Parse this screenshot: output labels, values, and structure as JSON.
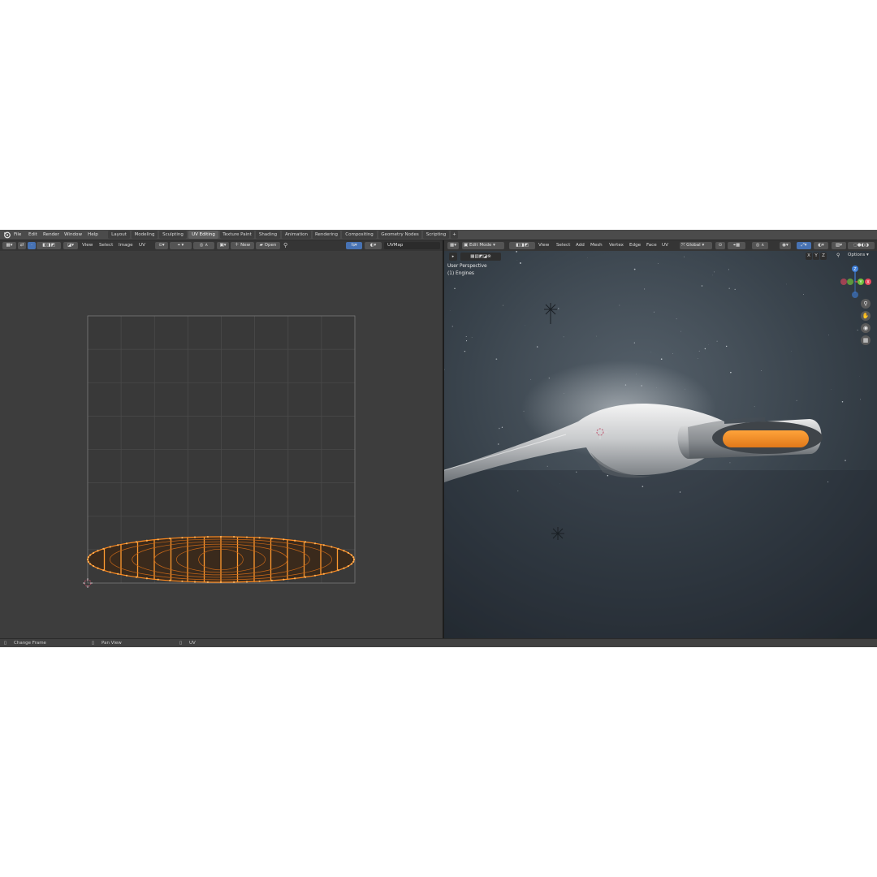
{
  "topbar": {
    "menus": [
      "File",
      "Edit",
      "Render",
      "Window",
      "Help"
    ],
    "workspace_tabs": [
      "Layout",
      "Modeling",
      "Sculpting",
      "UV Editing",
      "Texture Paint",
      "Shading",
      "Animation",
      "Rendering",
      "Compositing",
      "Geometry Nodes",
      "Scripting"
    ],
    "active_tab": "UV Editing",
    "add_tab": "+"
  },
  "uv_editor": {
    "menus": [
      "View",
      "Select",
      "Image",
      "UV"
    ],
    "new_label": "New",
    "open_label": "Open",
    "uvmap_label": "UVMap"
  },
  "viewport": {
    "mode_label": "Edit Mode",
    "menus": [
      "View",
      "Select",
      "Add",
      "Mesh",
      "Vertex",
      "Edge",
      "Face",
      "UV"
    ],
    "transform_label": "Global",
    "options_label": "Options",
    "axis_labels": [
      "X",
      "Y",
      "Z"
    ],
    "overlay_title": "User Perspective",
    "overlay_object": "(1) Engines",
    "gizmo": {
      "x": "X",
      "y": "Y",
      "z": "Z"
    }
  },
  "status_bar": {
    "items": [
      "Change Frame",
      "Pan View",
      "UV"
    ]
  },
  "colors": {
    "accent_orange": "#ff8a1e",
    "active_blue": "#4772b3",
    "axis_x": "#e84a5f",
    "axis_y": "#6fbf3c",
    "axis_z": "#3f7fd8"
  }
}
